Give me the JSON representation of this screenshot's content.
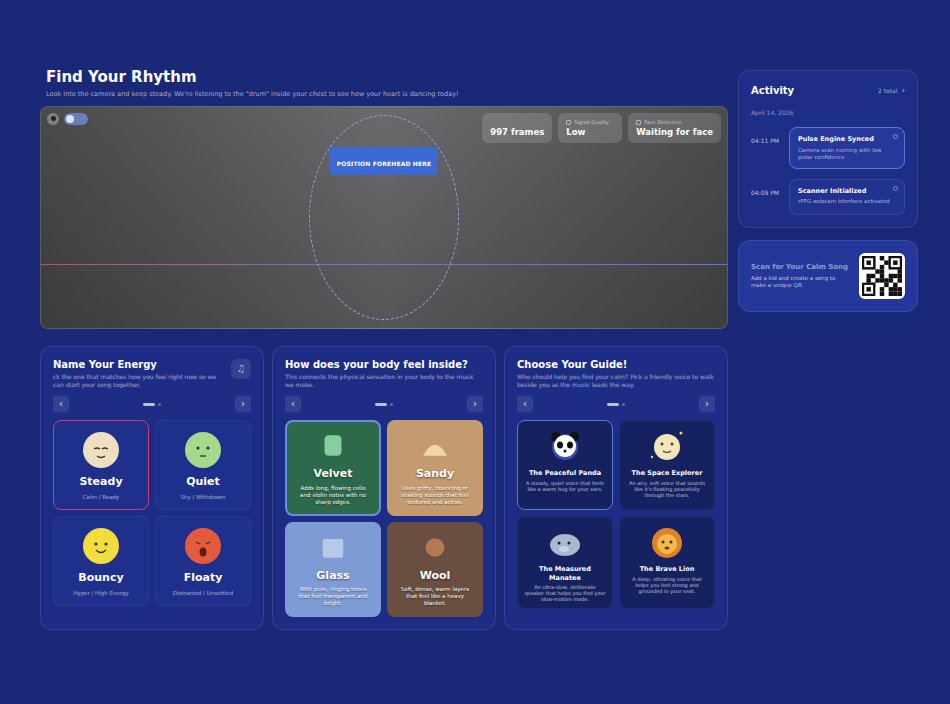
{
  "header": {
    "title": "Find Your Rhythm",
    "subtitle": "Look into the camera and keep steady. We're listening to the \"drum\" inside your chest to see how your heart is dancing today!"
  },
  "camera": {
    "badge": "POSITION FOREHEAD HERE",
    "stats": [
      {
        "value": "997 frames"
      },
      {
        "label": "Signal Quality",
        "value": "Low"
      },
      {
        "label": "Face Detection",
        "value": "Waiting for face"
      }
    ]
  },
  "activity": {
    "title": "Activity",
    "count": "2 total",
    "chevron": "›",
    "date": "April 14, 2026",
    "items": [
      {
        "time": "04:11 PM",
        "title": "Pulse Engine Synced",
        "detail": "Camera scan running with low pulse confidence",
        "selected": true
      },
      {
        "time": "04:09 PM",
        "title": "Scanner Initialized",
        "detail": "rPPG webcam interface activated",
        "selected": false
      }
    ]
  },
  "qr": {
    "title": "Scan for Your Calm Song",
    "text": "Add a kid and create a song to make a unique QR."
  },
  "panels": [
    {
      "kind": "mood",
      "title": "Name Your Energy",
      "subtitle": "ck the one that matches how you feel right now so we can start your song together.",
      "icon": "♫",
      "prev": "‹",
      "next": "›",
      "pages": [
        {
          "selected": true
        },
        {
          "selected": false
        }
      ],
      "cards": [
        {
          "name": "Steady",
          "caption": "Calm / Ready",
          "selected": true,
          "color": "#efdfc2"
        },
        {
          "name": "Quiet",
          "caption": "Shy / Withdrawn",
          "selected": false,
          "color": "#a6d98c"
        },
        {
          "name": "Bouncy",
          "caption": "Hyper / High Energy",
          "selected": false,
          "color": "#f4dc3c"
        },
        {
          "name": "Floaty",
          "caption": "Distracted / Unsettled",
          "selected": false,
          "color": "#e45a3c"
        }
      ]
    },
    {
      "kind": "texture",
      "title": "How does your body feel inside?",
      "subtitle": "This connects the physical sensation in your body to the music we make.",
      "prev": "‹",
      "next": "›",
      "pages": [
        {
          "selected": true
        },
        {
          "selected": false
        }
      ],
      "cards": [
        {
          "name": "Velvet",
          "caption": "Adds long, flowing cello and violin notes with no sharp edges.",
          "selected": true,
          "color": "#2d6a4c"
        },
        {
          "name": "Sandy",
          "caption": "Uses gritty, bouncing or shaking sounds that feel textured and active.",
          "selected": false,
          "color": "#c49b70"
        },
        {
          "name": "Glass",
          "caption": "With pure, ringing tones that feel transparent and bright.",
          "selected": false,
          "color": "#7f9bd6"
        },
        {
          "name": "Wool",
          "caption": "Soft, dense, warm layers that feel like a heavy blanket.",
          "selected": false,
          "color": "#6a4f40"
        }
      ]
    },
    {
      "kind": "guide",
      "title": "Choose Your Guide!",
      "subtitle": "Who should help you find your calm? Pick a friendly voice to walk beside you as the music leads the way.",
      "prev": "‹",
      "next": "›",
      "pages": [
        {
          "selected": true
        },
        {
          "selected": false
        }
      ],
      "cards": [
        {
          "name": "The Peaceful Panda",
          "caption": "A steady, quiet voice that feels like a warm hug for your ears.",
          "selected": true
        },
        {
          "name": "The Space Explorer",
          "caption": "An airy, soft voice that sounds like it's floating peacefully through the stars.",
          "selected": false
        },
        {
          "name": "The Measured Manatee",
          "caption": "An ultra-slow, deliberate speaker that helps you find your slow-motion mode.",
          "selected": false
        },
        {
          "name": "The Brave Lion",
          "caption": "A deep, vibrating voice that helps you feel strong and grounded in your seat.",
          "selected": false
        }
      ]
    }
  ]
}
